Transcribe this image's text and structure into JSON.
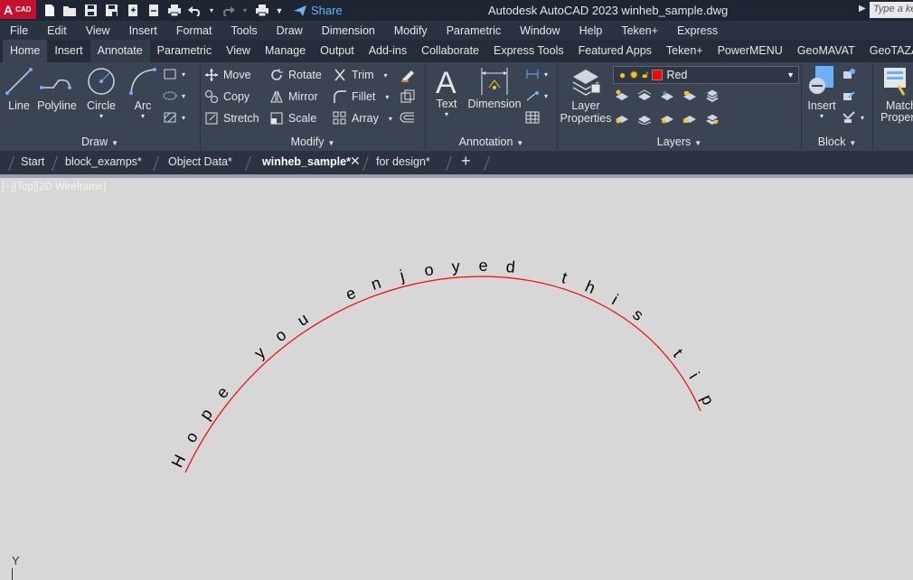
{
  "app": {
    "logo_big": "A",
    "logo_small": "CAD",
    "title": "Autodesk AutoCAD 2023   winheb_sample.dwg",
    "share_label": "Share",
    "search_placeholder": "Type a keyword or phrase"
  },
  "menu": [
    "File",
    "Edit",
    "View",
    "Insert",
    "Format",
    "Tools",
    "Draw",
    "Dimension",
    "Modify",
    "Parametric",
    "Window",
    "Help",
    "Teken+",
    "Express"
  ],
  "ribbon_tabs": [
    {
      "label": "Home",
      "active": true
    },
    {
      "label": "Insert"
    },
    {
      "label": "Annotate",
      "hover": true
    },
    {
      "label": "Parametric"
    },
    {
      "label": "View"
    },
    {
      "label": "Manage"
    },
    {
      "label": "Output"
    },
    {
      "label": "Add-ins"
    },
    {
      "label": "Collaborate"
    },
    {
      "label": "Express Tools"
    },
    {
      "label": "Featured Apps"
    },
    {
      "label": "Teken+"
    },
    {
      "label": "PowerMENU"
    },
    {
      "label": "GeoMAVAT"
    },
    {
      "label": "GeoTAZA"
    }
  ],
  "panels": {
    "draw": {
      "title": "Draw",
      "line": "Line",
      "polyline": "Polyline",
      "circle": "Circle",
      "arc": "Arc"
    },
    "modify": {
      "title": "Modify",
      "move": "Move",
      "rotate": "Rotate",
      "trim": "Trim",
      "copy": "Copy",
      "mirror": "Mirror",
      "fillet": "Fillet",
      "stretch": "Stretch",
      "scale": "Scale",
      "array": "Array"
    },
    "annotation": {
      "title": "Annotation",
      "text": "Text",
      "dimension": "Dimension"
    },
    "layers": {
      "title": "Layers",
      "layer_properties_1": "Layer",
      "layer_properties_2": "Properties",
      "current_layer": "Red",
      "current_layer_color": "#ff0000"
    },
    "block": {
      "title": "Block",
      "insert": "Insert"
    },
    "properties": {
      "match_1": "Match",
      "match_2": "Properties"
    }
  },
  "doc_tabs": [
    {
      "label": "Start"
    },
    {
      "label": "block_examps*"
    },
    {
      "label": "Object Data*"
    },
    {
      "label": "winheb_sample*",
      "active": true
    },
    {
      "label": "for design*"
    }
  ],
  "viewport_label": "[−][Top][2D Wireframe]",
  "drawing": {
    "arc_text": "Hope you enjoyed this tip",
    "arc_color": "#ff0000",
    "text_color": "#000000"
  },
  "ucs_axis_label": "Y"
}
